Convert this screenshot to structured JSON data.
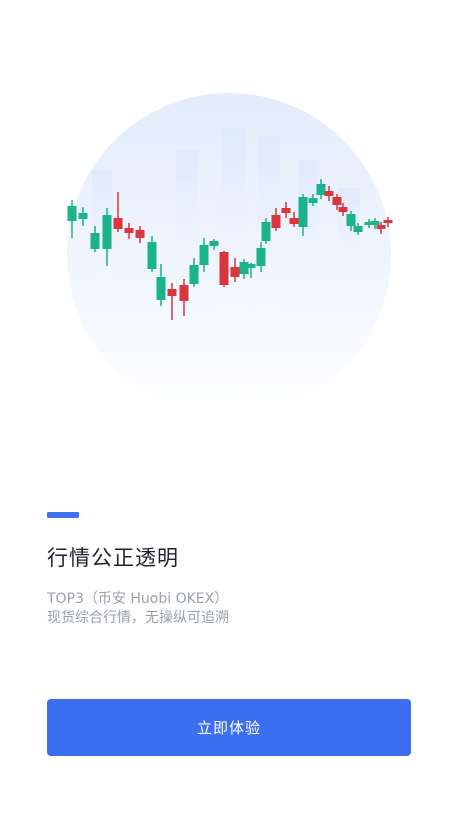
{
  "hero": {
    "illustration": "candlestick-market-chart-icon"
  },
  "onboarding": {
    "title": "行情公正透明",
    "description_line1": "TOP3（币安 Huobi OKEX）",
    "description_line2": "现货综合行情，无操纵可追溯",
    "cta_label": "立即体验"
  },
  "colors": {
    "accent": "#3e72ec",
    "button": "#3c6ff0",
    "up": "#1bb38a",
    "down": "#d9363e"
  }
}
